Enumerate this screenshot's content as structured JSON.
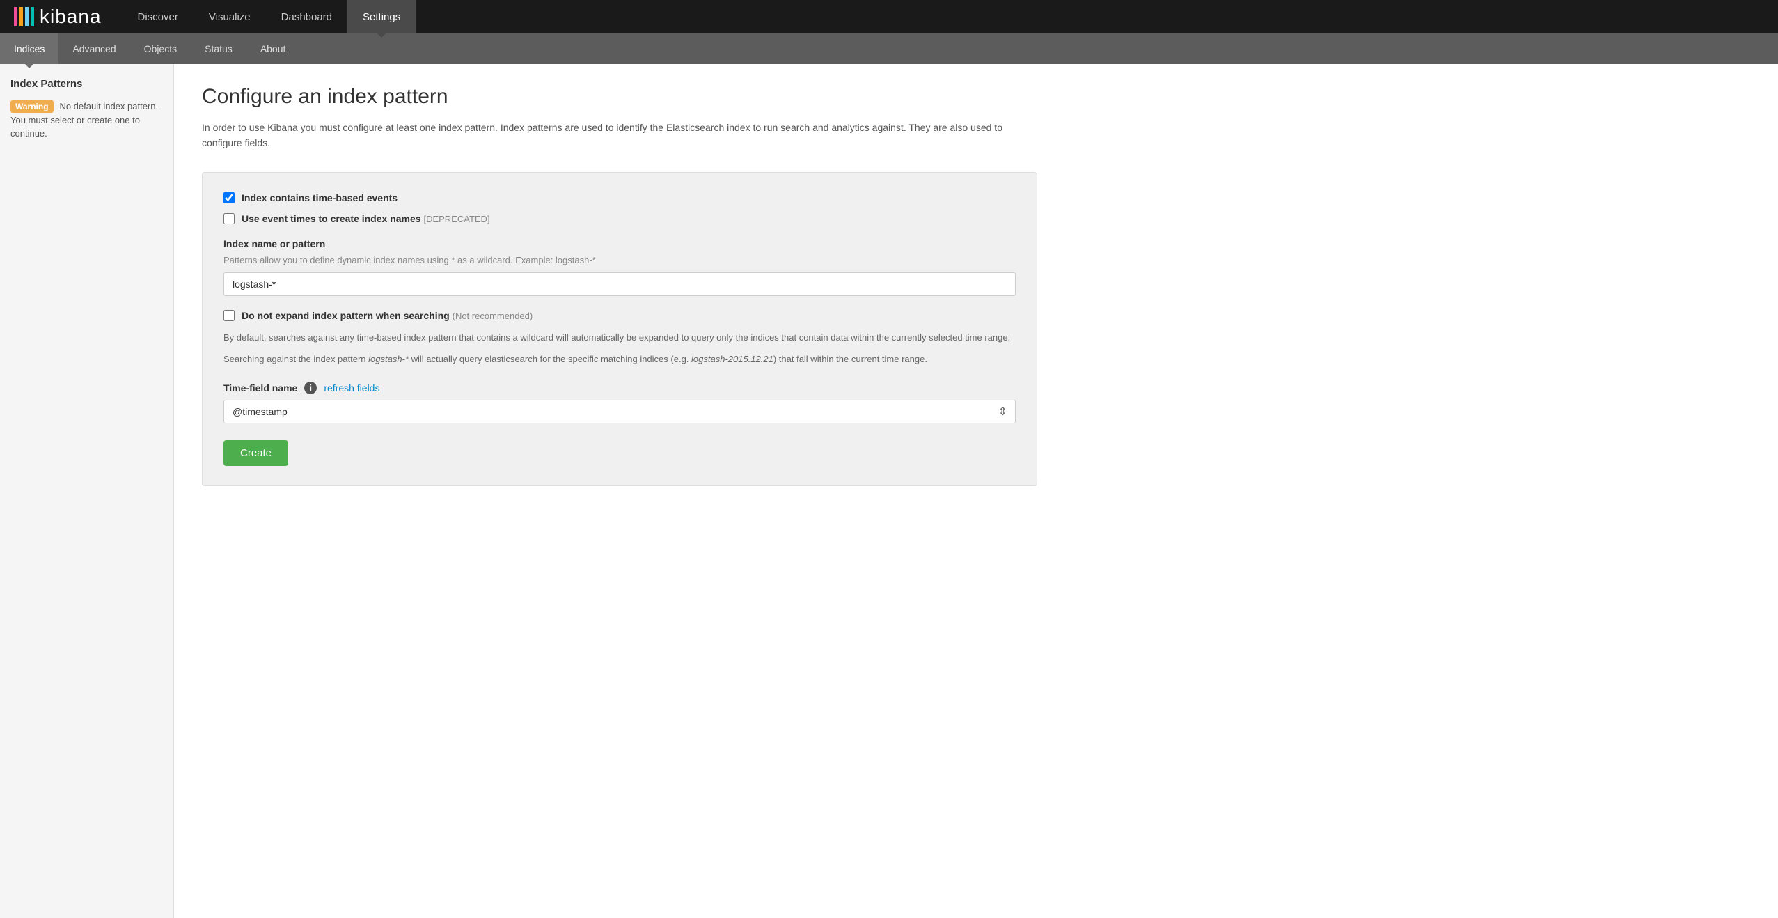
{
  "app": {
    "logo_text": "kibana"
  },
  "top_nav": {
    "items": [
      {
        "id": "discover",
        "label": "Discover",
        "active": false
      },
      {
        "id": "visualize",
        "label": "Visualize",
        "active": false
      },
      {
        "id": "dashboard",
        "label": "Dashboard",
        "active": false
      },
      {
        "id": "settings",
        "label": "Settings",
        "active": true
      }
    ]
  },
  "sub_nav": {
    "items": [
      {
        "id": "indices",
        "label": "Indices",
        "active": true
      },
      {
        "id": "advanced",
        "label": "Advanced",
        "active": false
      },
      {
        "id": "objects",
        "label": "Objects",
        "active": false
      },
      {
        "id": "status",
        "label": "Status",
        "active": false
      },
      {
        "id": "about",
        "label": "About",
        "active": false
      }
    ]
  },
  "sidebar": {
    "title": "Index Patterns",
    "warning_badge": "Warning",
    "warning_message": "No default index pattern. You must select or create one to continue."
  },
  "main": {
    "page_title": "Configure an index pattern",
    "page_description": "In order to use Kibana you must configure at least one index pattern. Index patterns are used to identify the Elasticsearch index to run search and analytics against. They are also used to configure fields.",
    "form": {
      "checkbox_time_based_label": "Index contains time-based events",
      "checkbox_time_based_checked": true,
      "checkbox_event_times_label": "Use event times to create index names",
      "checkbox_event_times_suffix": "[DEPRECATED]",
      "checkbox_event_times_checked": false,
      "index_name_section_label": "Index name or pattern",
      "index_name_hint": "Patterns allow you to define dynamic index names using * as a wildcard. Example: logstash-*",
      "index_name_value": "logstash-*",
      "checkbox_no_expand_label": "Do not expand index pattern when searching",
      "checkbox_no_expand_note": "(Not recommended)",
      "checkbox_no_expand_checked": false,
      "expand_description_1": "By default, searches against any time-based index pattern that contains a wildcard will automatically be expanded to query only the indices that contain data within the currently selected time range.",
      "expand_description_2_prefix": "Searching against the index pattern ",
      "expand_description_2_italic": "logstash-*",
      "expand_description_2_middle": " will actually query elasticsearch for the specific matching indices (e.g. ",
      "expand_description_2_italic2": "logstash-2015.12.21",
      "expand_description_2_suffix": ") that fall within the current time range.",
      "time_field_label": "Time-field name",
      "time_field_refresh": "refresh fields",
      "time_field_value": "@timestamp",
      "create_button_label": "Create"
    }
  }
}
